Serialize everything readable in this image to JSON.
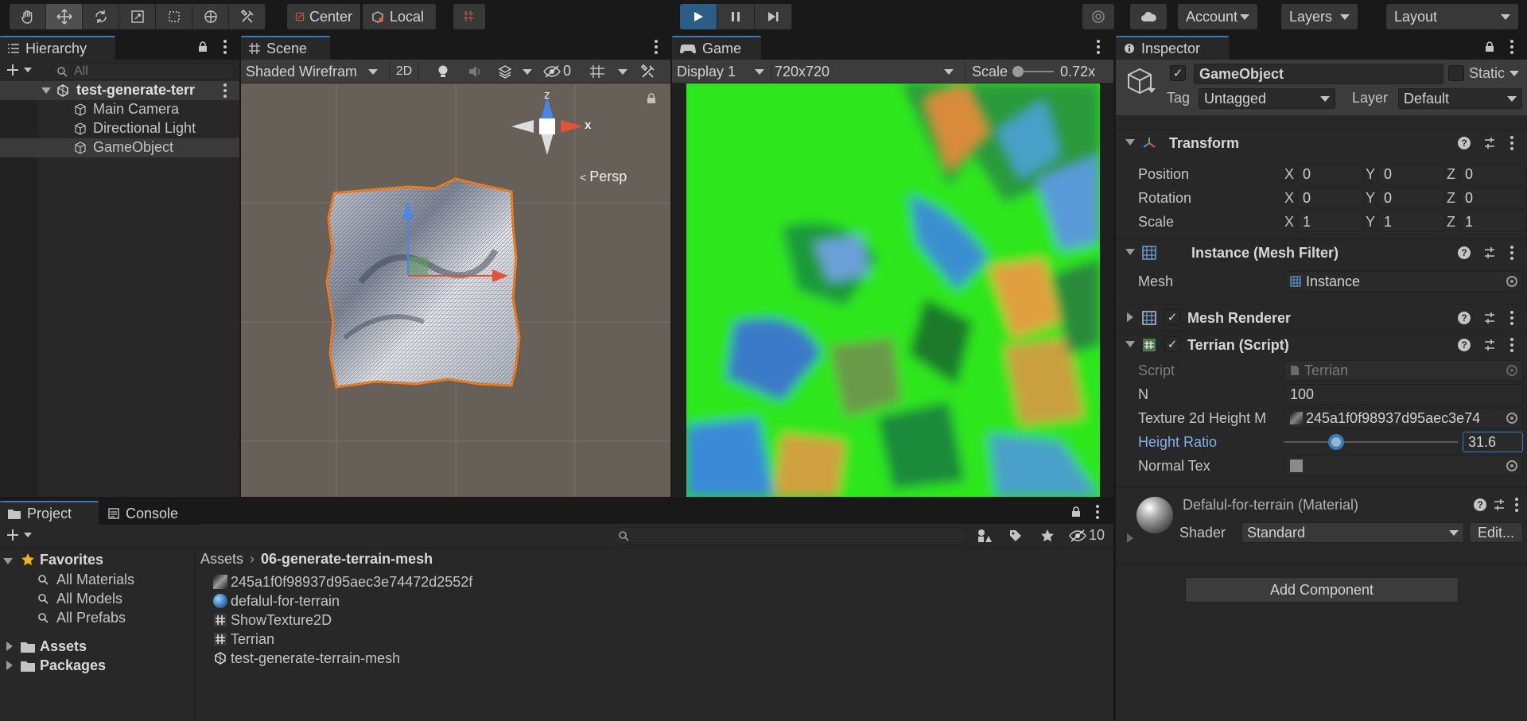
{
  "toolbar": {
    "pivot": "Center",
    "space": "Local",
    "account": "Account",
    "layers": "Layers",
    "layout": "Layout"
  },
  "hierarchy": {
    "tab": "Hierarchy",
    "search_placeholder": "All",
    "scene": "test-generate-terr",
    "items": [
      "Main Camera",
      "Directional Light",
      "GameObject"
    ]
  },
  "scene": {
    "tab": "Scene",
    "shading": "Shaded Wirefram",
    "mode2d": "2D",
    "hidden_count": "0",
    "persp": "Persp",
    "axis_x": "x",
    "axis_z": "z"
  },
  "game": {
    "tab": "Game",
    "display": "Display 1",
    "resolution": "720x720",
    "scale_label": "Scale",
    "scale_value": "0.72x"
  },
  "inspector": {
    "tab": "Inspector",
    "object_name": "GameObject",
    "static": "Static",
    "tag_label": "Tag",
    "tag": "Untagged",
    "layer_label": "Layer",
    "layer": "Default",
    "transform": {
      "title": "Transform",
      "position_label": "Position",
      "rotation_label": "Rotation",
      "scale_label": "Scale",
      "position": [
        "0",
        "0",
        "0"
      ],
      "rotation": [
        "0",
        "0",
        "0"
      ],
      "scale": [
        "1",
        "1",
        "1"
      ],
      "axes": [
        "X",
        "Y",
        "Z"
      ]
    },
    "mesh_filter": {
      "title": "Instance (Mesh Filter)",
      "mesh_label": "Mesh",
      "mesh": "Instance"
    },
    "mesh_renderer": {
      "title": "Mesh Renderer"
    },
    "terrain": {
      "title": "Terrian (Script)",
      "script_label": "Script",
      "script": "Terrian",
      "n_label": "N",
      "n": "100",
      "tex_label": "Texture 2d Height M",
      "tex": "245a1f0f98937d95aec3e74",
      "height_label": "Height Ratio",
      "height": "31.6",
      "height_fraction": 0.3,
      "normal_label": "Normal Tex"
    },
    "material": {
      "title": "Defalul-for-terrain (Material)",
      "shader_label": "Shader",
      "shader": "Standard",
      "edit": "Edit..."
    },
    "add_component": "Add Component"
  },
  "project": {
    "tab_project": "Project",
    "tab_console": "Console",
    "hidden_count": "10",
    "favorites": "Favorites",
    "fav_items": [
      "All Materials",
      "All Models",
      "All Prefabs"
    ],
    "roots": [
      "Assets",
      "Packages"
    ],
    "breadcrumb_root": "Assets",
    "breadcrumb_folder": "06-generate-terrain-mesh",
    "files": [
      "245a1f0f98937d95aec3e74472d2552f",
      "defalul-for-terrain",
      "ShowTexture2D",
      "Terrian",
      "test-generate-terrain-mesh"
    ]
  },
  "colors": {
    "accent": "#3a79bb",
    "selection": "#2c5d87",
    "outline": "#f47d20"
  }
}
